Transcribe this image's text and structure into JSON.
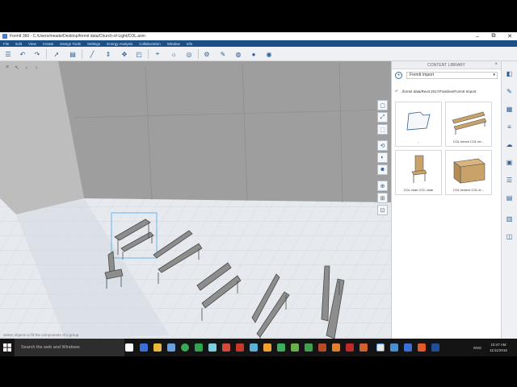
{
  "window": {
    "title": "FormIt 360 - C:/Users/meade/Desktop/formit data/Church-of-Light/COL.axm",
    "minimize": "–",
    "maximize": "⧉",
    "close": "✕"
  },
  "menu": [
    "File",
    "Edit",
    "View",
    "Create",
    "Design Tools",
    "Settings",
    "Energy Analysis",
    "Collaboration",
    "Window",
    "Info"
  ],
  "viewport": {
    "status_text": "Select objects to fill the components of a group"
  },
  "panel": {
    "title": "CONTENT LIBRARY",
    "close": "×",
    "add": "+",
    "dropdown_value": "FormIt Import",
    "path": "../formit data/Revit 2017/Families/FormIt Import",
    "items": [
      {
        "label": "..",
        "name": "folder-up"
      },
      {
        "label": "COL bench COL be...",
        "name": "bench"
      },
      {
        "label": "COL chair COL chair",
        "name": "chair"
      },
      {
        "label": "COL lectern COL le...",
        "name": "lectern"
      }
    ]
  },
  "taskbar": {
    "search_placeholder": "Search the web and Windows",
    "lang": "ENG",
    "time": "10:47 AM",
    "date": "11/11/2016"
  },
  "colors": {
    "menubar": "#1c4f86",
    "accent": "#2f6fb8",
    "wall": "#9c9c9c",
    "floor": "#e4e8ec",
    "taskbar": "#141414"
  }
}
